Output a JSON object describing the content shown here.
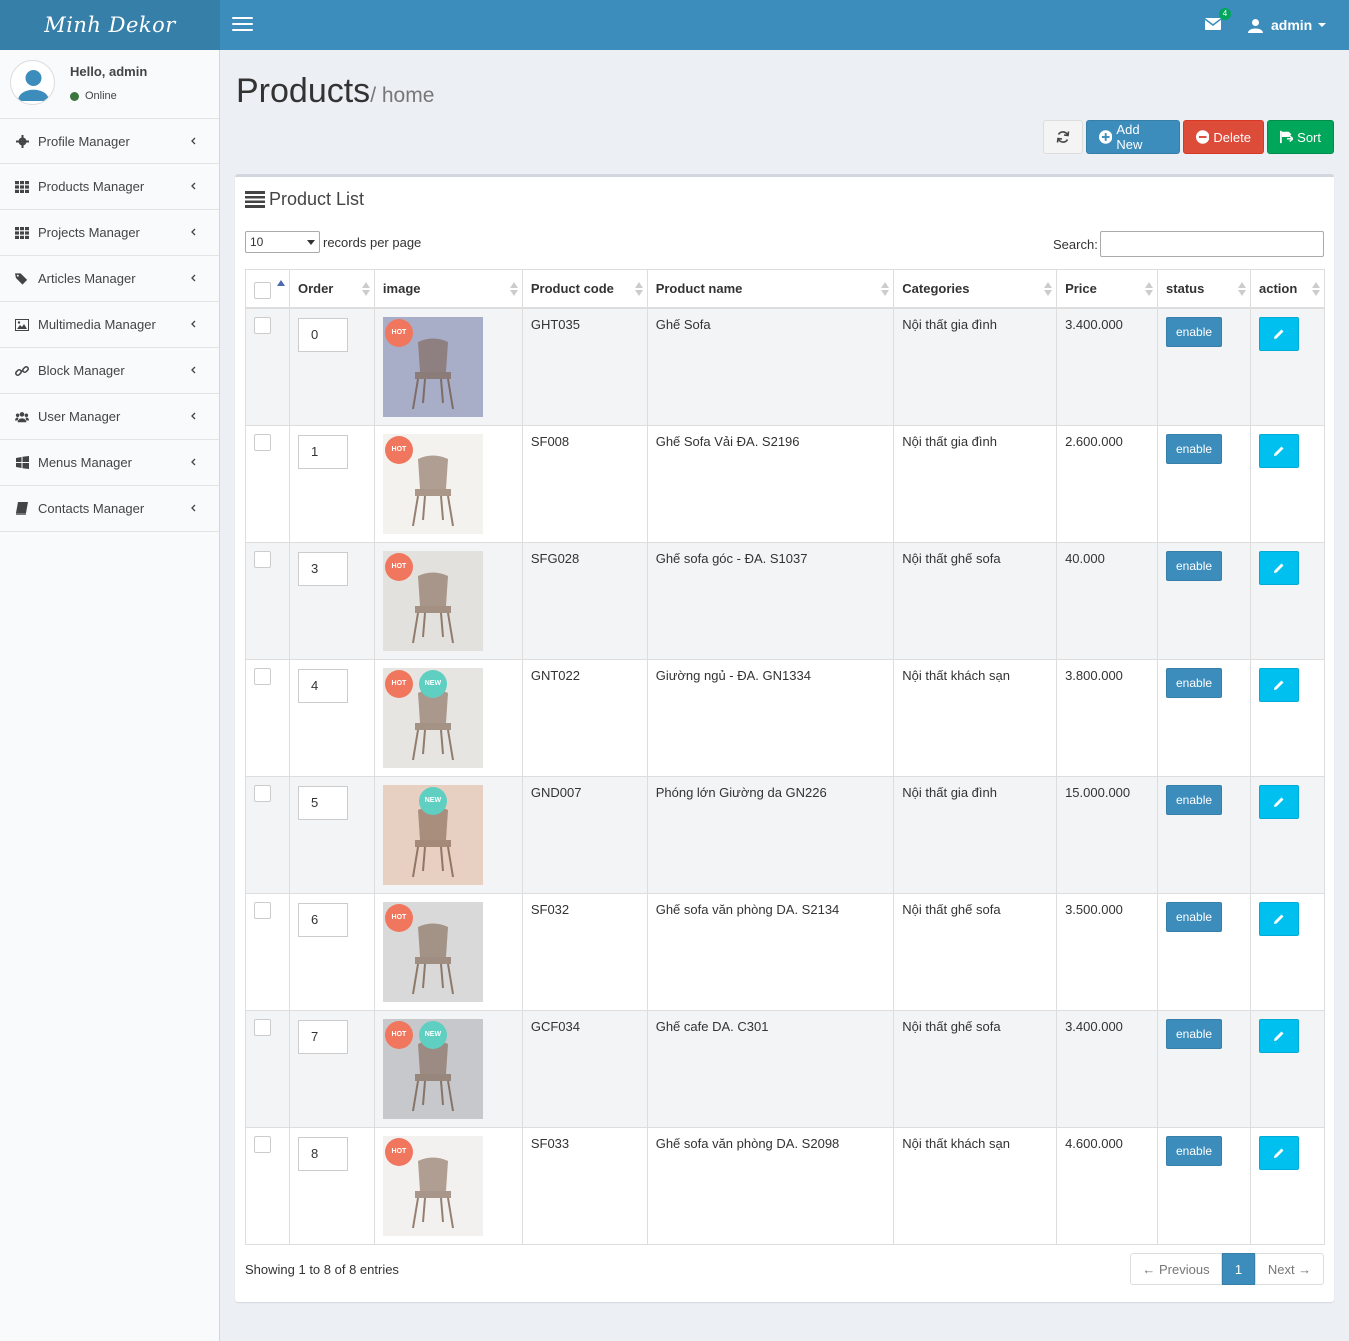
{
  "brand": {
    "name": "Minh Dekor"
  },
  "header": {
    "mail_count": "4",
    "user_name": "admin"
  },
  "sidebar": {
    "greeting": "Hello, admin",
    "status": "Online",
    "items": [
      {
        "label": "Profile Manager",
        "icon": "gear-icon"
      },
      {
        "label": "Products Manager",
        "icon": "grid-icon"
      },
      {
        "label": "Projects Manager",
        "icon": "grid-icon"
      },
      {
        "label": "Articles Manager",
        "icon": "tags-icon"
      },
      {
        "label": "Multimedia Manager",
        "icon": "image-icon"
      },
      {
        "label": "Block Manager",
        "icon": "link-icon"
      },
      {
        "label": "User Manager",
        "icon": "users-icon"
      },
      {
        "label": "Menus Manager",
        "icon": "windows-icon"
      },
      {
        "label": "Contacts Manager",
        "icon": "book-icon"
      }
    ]
  },
  "page": {
    "title": "Products",
    "subtitle": "/ home"
  },
  "toolbar": {
    "add_label": "Add New",
    "delete_label": "Delete",
    "sort_label": "Sort"
  },
  "list": {
    "title": "Product List",
    "page_size": "10",
    "page_size_label": "records per page",
    "search_label": "Search:",
    "search_value": "",
    "columns": [
      "Order",
      "image",
      "Product code",
      "Product name",
      "Categories",
      "Price",
      "status",
      "action"
    ],
    "rows": [
      {
        "order": "0",
        "code": "GHT035",
        "name": "Ghế Sofa",
        "category": "Nội thất gia đình",
        "price": "3.400.000",
        "status": "enable",
        "hot": true,
        "new": false,
        "img_bg": "#a9aec8"
      },
      {
        "order": "1",
        "code": "SF008",
        "name": "Ghế Sofa Vải ĐA. S2196",
        "category": "Nội thất gia đình",
        "price": "2.600.000",
        "status": "enable",
        "hot": true,
        "new": false,
        "img_bg": "#f4f2ef"
      },
      {
        "order": "3",
        "code": "SFG028",
        "name": "Ghế sofa góc - ĐA. S1037",
        "category": "Nội thất ghế sofa",
        "price": "40.000",
        "status": "enable",
        "hot": true,
        "new": false,
        "img_bg": "#e3e1dd"
      },
      {
        "order": "4",
        "code": "GNT022",
        "name": "Giường ngủ - ĐA. GN1334",
        "category": "Nội thất khách sạn",
        "price": "3.800.000",
        "status": "enable",
        "hot": true,
        "new": true,
        "img_bg": "#e6e5e2"
      },
      {
        "order": "5",
        "code": "GND007",
        "name": "Phóng lớn Giường da GN226",
        "category": "Nội thất gia đình",
        "price": "15.000.000",
        "status": "enable",
        "hot": false,
        "new": true,
        "img_bg": "#e7cfc2"
      },
      {
        "order": "6",
        "code": "SF032",
        "name": "Ghế sofa văn phòng DA. S2134",
        "category": "Nội thất ghế sofa",
        "price": "3.500.000",
        "status": "enable",
        "hot": true,
        "new": false,
        "img_bg": "#d8d9d8"
      },
      {
        "order": "7",
        "code": "GCF034",
        "name": "Ghế cafe DA. C301",
        "category": "Nội thất ghế sofa",
        "price": "3.400.000",
        "status": "enable",
        "hot": true,
        "new": true,
        "img_bg": "#c6c8cc"
      },
      {
        "order": "8",
        "code": "SF033",
        "name": "Ghế sofa văn phòng DA. S2098",
        "category": "Nội thất khách sạn",
        "price": "4.600.000",
        "status": "enable",
        "hot": true,
        "new": false,
        "img_bg": "#f3f1ef"
      }
    ],
    "badges": {
      "hot": "HOT",
      "new": "NEW"
    },
    "info": "Showing 1 to 8 of 8 entries",
    "pager": {
      "prev": "← Previous",
      "current": "1",
      "next": "Next →"
    }
  }
}
